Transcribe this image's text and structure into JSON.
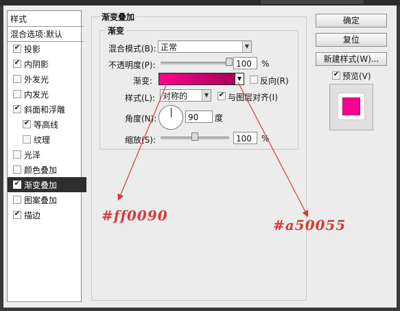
{
  "style_list": {
    "header": "样式",
    "blend_default": "混合选项:默认",
    "items": [
      {
        "label": "投影",
        "checked": true,
        "indent": false
      },
      {
        "label": "内阴影",
        "checked": true,
        "indent": false
      },
      {
        "label": "外发光",
        "checked": false,
        "indent": false
      },
      {
        "label": "内发光",
        "checked": false,
        "indent": false
      },
      {
        "label": "斜面和浮雕",
        "checked": true,
        "indent": false
      },
      {
        "label": "等高线",
        "checked": true,
        "indent": true
      },
      {
        "label": "纹理",
        "checked": false,
        "indent": true
      },
      {
        "label": "光泽",
        "checked": false,
        "indent": false
      },
      {
        "label": "颜色叠加",
        "checked": false,
        "indent": false
      },
      {
        "label": "渐变叠加",
        "checked": true,
        "indent": false,
        "selected": true
      },
      {
        "label": "图案叠加",
        "checked": false,
        "indent": false
      },
      {
        "label": "描边",
        "checked": true,
        "indent": false
      }
    ]
  },
  "panel": {
    "outer_title": "渐变叠加",
    "inner_title": "渐变",
    "blend_mode_label": "混合模式(B):",
    "blend_mode_value": "正常",
    "opacity_label": "不透明度(P):",
    "opacity_value": "100",
    "opacity_unit": "%",
    "opacity_level": 1.0,
    "gradient_label": "渐变:",
    "reverse_label": "反向(R)",
    "reverse_checked": false,
    "style_label": "样式(L):",
    "style_value": "对称的",
    "align_label": "与图层对齐(I)",
    "align_checked": true,
    "angle_label": "角度(N):",
    "angle_value": "90",
    "angle_unit": "度",
    "scale_label": "缩放(S):",
    "scale_value": "100",
    "scale_unit": "%",
    "scale_level": 0.5
  },
  "buttons": {
    "ok": "确定",
    "reset": "复位",
    "new_style": "新建样式(W)...",
    "preview_label": "预览(V)",
    "preview_checked": true
  },
  "annotations": {
    "left_color": "#ff0090",
    "right_color": "#a50055"
  },
  "colors": {
    "gradient_start": "#ff0090",
    "gradient_end": "#a50055",
    "annotation": "#d23a3a"
  }
}
